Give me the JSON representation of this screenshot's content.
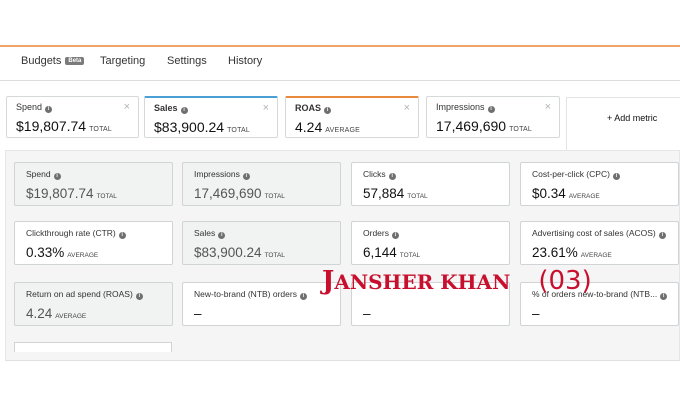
{
  "tabs": {
    "budgets": "Budgets",
    "beta": "Beta",
    "targeting": "Targeting",
    "settings": "Settings",
    "history": "History"
  },
  "top_cards": [
    {
      "label": "Spend",
      "value": "$19,807.74",
      "sub": "TOTAL"
    },
    {
      "label": "Sales",
      "value": "$83,900.24",
      "sub": "TOTAL",
      "accent": "#4a9fd5"
    },
    {
      "label": "ROAS",
      "value": "4.24",
      "sub": "AVERAGE",
      "accent": "#e9893b"
    },
    {
      "label": "Impressions",
      "value": "17,469,690",
      "sub": "TOTAL"
    }
  ],
  "close_glyph": "×",
  "add_metric": "+ Add metric",
  "metrics": [
    {
      "label": "Spend",
      "value": "$19,807.74",
      "sub": "TOTAL",
      "selected": true
    },
    {
      "label": "Impressions",
      "value": "17,469,690",
      "sub": "TOTAL",
      "selected": true
    },
    {
      "label": "Clicks",
      "value": "57,884",
      "sub": "TOTAL"
    },
    {
      "label": "Cost-per-click (CPC)",
      "value": "$0.34",
      "sub": "AVERAGE"
    },
    {
      "label": "Clickthrough rate (CTR)",
      "value": "0.33%",
      "sub": "AVERAGE"
    },
    {
      "label": "Sales",
      "value": "$83,900.24",
      "sub": "TOTAL",
      "selected": true
    },
    {
      "label": "Orders",
      "value": "6,144",
      "sub": "TOTAL"
    },
    {
      "label": "Advertising cost of sales (ACOS)",
      "value": "23.61%",
      "sub": "AVERAGE"
    },
    {
      "label": "Return on ad spend (ROAS)",
      "value": "4.24",
      "sub": "AVERAGE",
      "selected": true
    },
    {
      "label": "New-to-brand (NTB) orders",
      "value": "–",
      "sub": ""
    },
    {
      "label": "",
      "value": "–",
      "sub": ""
    },
    {
      "label": "% of orders new-to-brand (NTB...",
      "value": "–",
      "sub": ""
    }
  ],
  "watermark": {
    "j": "J",
    "rest": "ANSHER KHAN",
    "num": "(03)"
  },
  "colors": {
    "orange_rule": "#f0a36a",
    "sales_accent": "#4a9fd5",
    "roas_accent": "#e9893b",
    "watermark": "#c8102e"
  },
  "icons": {
    "info": "info-icon",
    "close": "close-icon",
    "plus": "plus-icon"
  }
}
